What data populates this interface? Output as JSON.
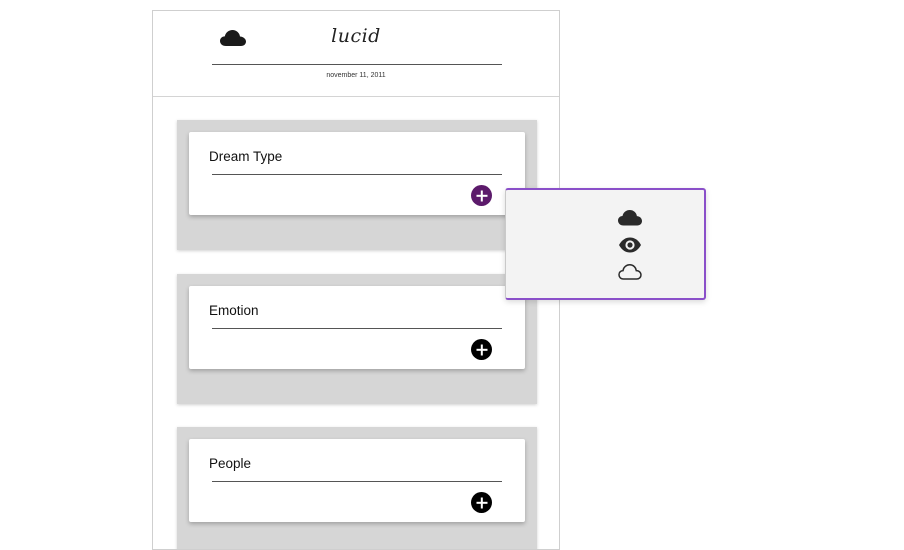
{
  "header": {
    "title": "lucid",
    "date": "november 11, 2011",
    "logo_icon": "cloud-icon"
  },
  "sections": [
    {
      "label": "Dream Type",
      "add_icon": "plus-circle-icon",
      "active": true
    },
    {
      "label": "Emotion",
      "add_icon": "plus-circle-icon",
      "active": false
    },
    {
      "label": "People",
      "add_icon": "plus-circle-icon",
      "active": false
    }
  ],
  "popup": {
    "options": [
      {
        "icon": "cloud-filled-icon"
      },
      {
        "icon": "eye-icon"
      },
      {
        "icon": "cloud-outline-icon"
      }
    ]
  },
  "colors": {
    "accent_purple": "#5c1a6b",
    "popup_border": "#8a4fc9",
    "section_bg": "#d6d6d6"
  }
}
